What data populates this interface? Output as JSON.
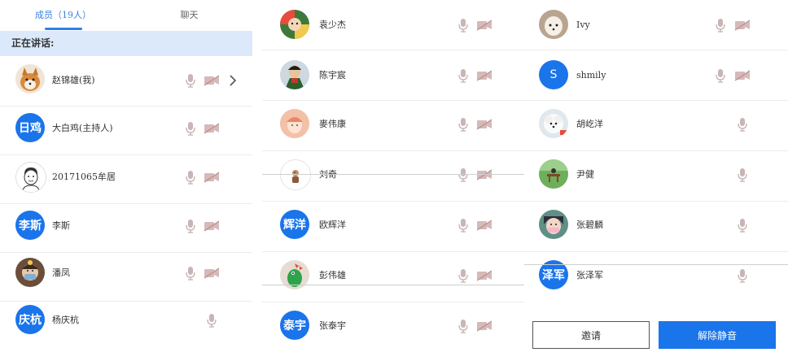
{
  "tabs": [
    {
      "label": "成员（19人）",
      "active": true
    },
    {
      "label": "聊天",
      "active": false
    }
  ],
  "section": {
    "speaking_label": "正在讲话:"
  },
  "icons": {
    "mic": "microphone-icon",
    "cam": "camera-off-icon",
    "chevron": "chevron-right-icon",
    "mic_color": "#c8b5b5",
    "cam_color": "#c9a9a9"
  },
  "colors": {
    "accent": "#1a74ea",
    "header_bg": "#dbe9fb"
  },
  "left_members": [
    {
      "name": "赵锦雄(我)",
      "avatar": "dog-photo"
    },
    {
      "name": "大白鸡(主持人)",
      "avatar_text": "日鸡"
    },
    {
      "name": "20171065牟居",
      "avatar": "cartoon-face"
    },
    {
      "name": "李斯",
      "avatar_text": "李斯"
    },
    {
      "name": "潘凤",
      "avatar": "masked-person"
    },
    {
      "name": "杨庆杭",
      "avatar_text": "庆杭"
    }
  ],
  "mid_members": [
    {
      "name": "袁少杰",
      "avatar": "colorful-cartoon"
    },
    {
      "name": "陈宇宸",
      "avatar": "lupin-anime"
    },
    {
      "name": "麥伟康",
      "avatar": "peach-anime"
    },
    {
      "name": "刘奇",
      "avatar": "small-figure"
    },
    {
      "name": "欧辉洋",
      "avatar_text": "辉洋"
    },
    {
      "name": "彭伟雄",
      "avatar": "green-dino"
    },
    {
      "name": "张泰宇",
      "avatar_text": "泰宇"
    }
  ],
  "right_members": [
    {
      "name": "Ivy",
      "avatar": "white-dog"
    },
    {
      "name": "shmily",
      "avatar_text": "S"
    },
    {
      "name": "胡屹洋",
      "avatar": "fluffy-dog"
    },
    {
      "name": "尹健",
      "avatar": "park-bench"
    },
    {
      "name": "张碧麟",
      "avatar": "anime-girl"
    },
    {
      "name": "张泽军",
      "avatar_text": "泽军"
    }
  ],
  "buttons": {
    "invite": "邀请",
    "unmute_all": "解除静音"
  }
}
